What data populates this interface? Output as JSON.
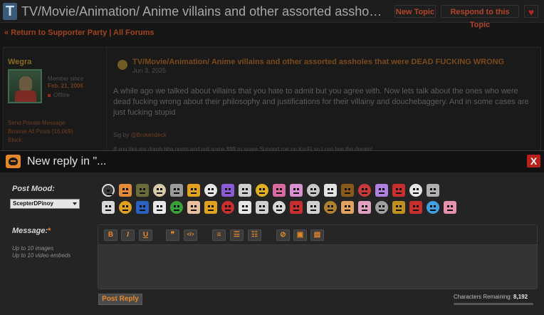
{
  "topbar": {
    "logo_letter": "T",
    "title": "TV/Movie/Animation/ Anime villains and other assorted assholes that were DE...",
    "new_topic": "New Topic",
    "respond": "Respond to this Topic",
    "fav_icon": "heart-icon"
  },
  "backlink": "« Return to Supporter Party | All Forums",
  "post": {
    "username": "Wegra",
    "member_since_label": "Member since",
    "member_since": "Feb. 21, 2006",
    "status": "Offline",
    "links": [
      "Send Private Message",
      "Browse All Posts (16,069)",
      "Block"
    ],
    "title": "TV/Movie/Animation/ Anime villains and other assorted assholes that were DEAD FUCKING WRONG",
    "date": "Jun 3, 2025",
    "body": "A while ago we talked about villains that you hate to admit but you agree with. Now lets talk about the ones who were dead fucking wrong about their philosophy and justifications for their villainy and douchebaggery. And in some cases are just fucking stupid",
    "sig_prefix": "Sig by ",
    "sig_author": "@Brokendeck",
    "sig_line2": "If you like my dumb bba posts and got some $$$ to spare Support me on Ko-Fi so I can live the dream!"
  },
  "modal": {
    "title": "New reply in \"...",
    "close": "X",
    "mood_label": "Post Mood:",
    "mood_value": "ScepterDPinoy",
    "message_label": "Message:",
    "required_mark": "*",
    "limit_images": "Up to 10 images",
    "limit_video": "Up to 10 video embeds",
    "toolbar": [
      {
        "name": "bold-button",
        "glyph": "B"
      },
      {
        "name": "italic-button",
        "glyph": "I"
      },
      {
        "name": "underline-button",
        "glyph": "U"
      },
      {
        "name": "quote-button",
        "glyph": "❞"
      },
      {
        "name": "code-button",
        "glyph": "</>"
      },
      {
        "name": "align-left-button",
        "glyph": "≡"
      },
      {
        "name": "ordered-list-button",
        "glyph": "☰"
      },
      {
        "name": "unordered-list-button",
        "glyph": "☷"
      },
      {
        "name": "link-button",
        "glyph": "⊘"
      },
      {
        "name": "image-button",
        "glyph": "▣"
      },
      {
        "name": "video-button",
        "glyph": "▤"
      }
    ],
    "post_reply": "Post Reply",
    "chars_label": "Characters Remaining:",
    "chars_value": "8,192"
  },
  "moods": [
    "#3c3c3c",
    "#e08a3a",
    "#6a6a3a",
    "#d8c9a8",
    "#9a9a9a",
    "#e0a020",
    "#e6e6e6",
    "#8e5bd6",
    "#cfcfcf",
    "#e0b020",
    "#d86aa0",
    "#d890d0",
    "#c8c8c8",
    "#e2e2e2",
    "#8a5a1a",
    "#c83a3a",
    "#b080e0",
    "#c83030",
    "#e6e6e6",
    "#b0b0b0",
    "#d8d8d8",
    "#e0a020",
    "#2a60c0",
    "#e8e8e8",
    "#3aa03a",
    "#e8c0a0",
    "#e0a020",
    "#c83030",
    "#e6e6e6",
    "#d0d0d0",
    "#d8d8d8",
    "#c83030",
    "#d0d0d0",
    "#b08030",
    "#e0a060",
    "#e0a0c0",
    "#a0a0a0",
    "#c09020",
    "#c83030",
    "#40a0e0",
    "#e890b0"
  ],
  "colors": {
    "accent": "#e6862a",
    "close": "#b8201a"
  }
}
